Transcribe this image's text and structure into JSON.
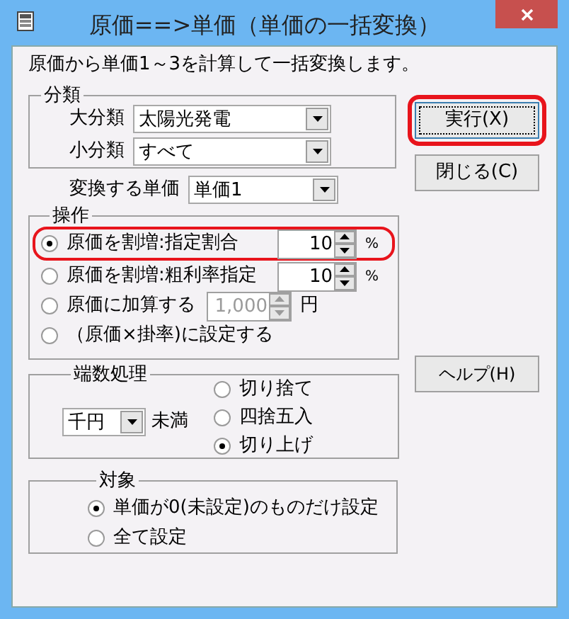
{
  "window": {
    "title": "原価==>単価（単価の一括変換）"
  },
  "description": "原価から単価1～3を計算して一括変換します。",
  "category_group": {
    "title": "分類",
    "fields": [
      {
        "label": "大分類",
        "value": "太陽光発電"
      },
      {
        "label": "小分類",
        "value": "すべて"
      }
    ]
  },
  "price_select": {
    "label": "変換する単価",
    "value": "単価1"
  },
  "operation_group": {
    "title": "操作",
    "options": [
      {
        "kind": "spinner",
        "label": "原価を割増:指定割合",
        "selected": true,
        "highlighted": true,
        "value": "10",
        "unit": "%",
        "disabled": false
      },
      {
        "kind": "spinner",
        "label": "原価を割増:粗利率指定",
        "selected": false,
        "highlighted": false,
        "value": "10",
        "unit": "%",
        "disabled": false
      },
      {
        "kind": "spinner",
        "label": "原価に加算する",
        "selected": false,
        "highlighted": false,
        "value": "1,000",
        "unit": "円",
        "disabled": true
      },
      {
        "kind": "plain",
        "label": "（原価×掛率)に設定する",
        "selected": false,
        "highlighted": false
      }
    ]
  },
  "rounding_group": {
    "title": "端数処理",
    "unit_select": {
      "value": "千円"
    },
    "unit_suffix": "未満",
    "options": [
      {
        "label": "切り捨て",
        "selected": false
      },
      {
        "label": "四捨五入",
        "selected": false
      },
      {
        "label": "切り上げ",
        "selected": true
      }
    ]
  },
  "target_group": {
    "title": "対象",
    "options": [
      {
        "label": "単価が0(未設定)のものだけ設定",
        "selected": true
      },
      {
        "label": "全て設定",
        "selected": false
      }
    ]
  },
  "buttons": [
    {
      "label": "実行(X)",
      "focused": true,
      "highlighted": true
    },
    {
      "label": "閉じる(C)",
      "focused": false,
      "highlighted": false
    }
  ],
  "help_button": {
    "label": "ヘルプ(H)"
  }
}
